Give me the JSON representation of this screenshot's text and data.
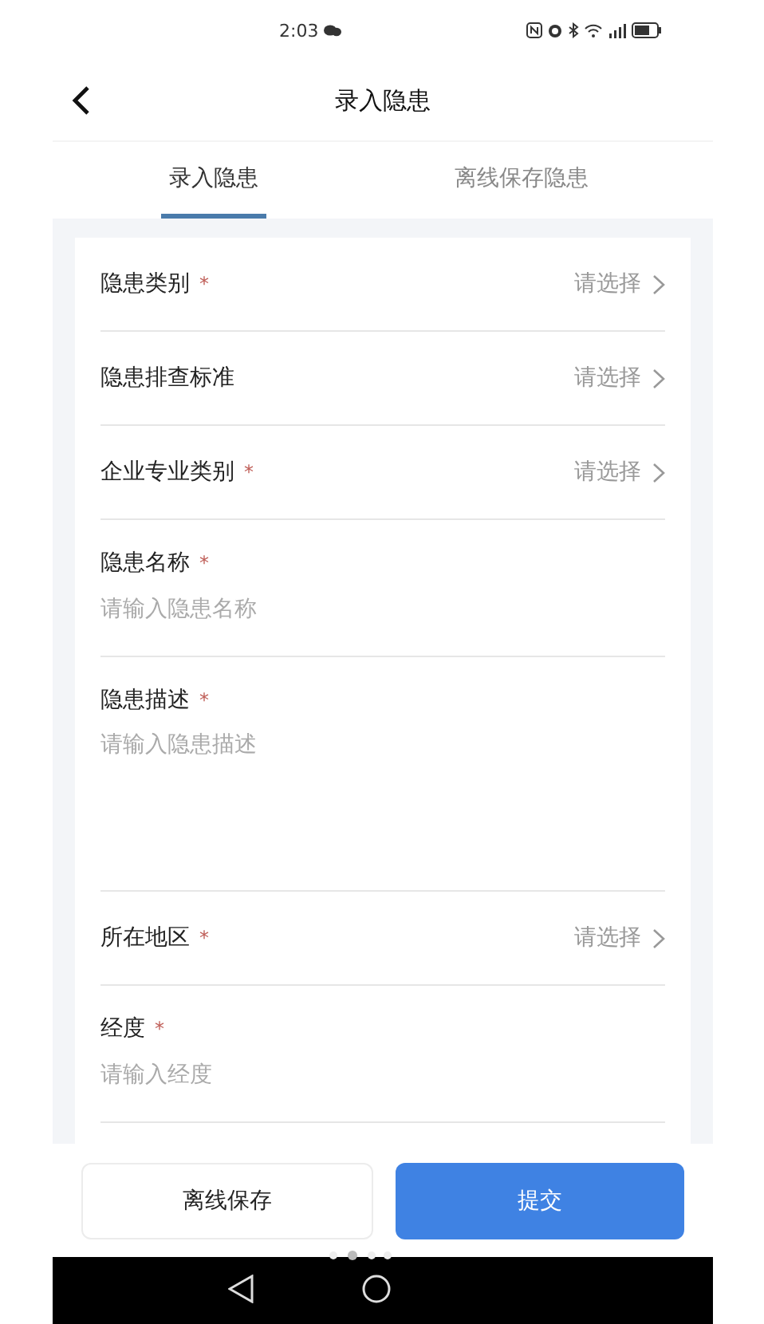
{
  "status_bar": {
    "time": "2:03"
  },
  "header": {
    "title": "录入隐患"
  },
  "tabs": [
    {
      "label": "录入隐患",
      "selected": true
    },
    {
      "label": "离线保存隐患",
      "selected": false
    }
  ],
  "form": {
    "fields": [
      {
        "kind": "select",
        "label": "隐患类别",
        "required_mark": "*",
        "placeholder": "请选择"
      },
      {
        "kind": "select",
        "label": "隐患排查标准",
        "placeholder": "请选择"
      },
      {
        "kind": "select",
        "label": "企业专业类别",
        "required_mark": "*",
        "placeholder": "请选择"
      },
      {
        "kind": "input",
        "label": "隐患名称",
        "required_mark": "*",
        "placeholder": "请输入隐患名称"
      },
      {
        "kind": "textarea",
        "label": "隐患描述",
        "required_mark": "*",
        "placeholder": "请输入隐患描述"
      },
      {
        "kind": "select",
        "label": "所在地区",
        "required_mark": "*",
        "placeholder": "请选择"
      },
      {
        "kind": "input",
        "label": "经度",
        "required_mark": "*",
        "placeholder": "请输入经度"
      }
    ]
  },
  "buttons": [
    {
      "kind": "secondary",
      "label": "离线保存"
    },
    {
      "kind": "primary",
      "label": "提交"
    }
  ]
}
